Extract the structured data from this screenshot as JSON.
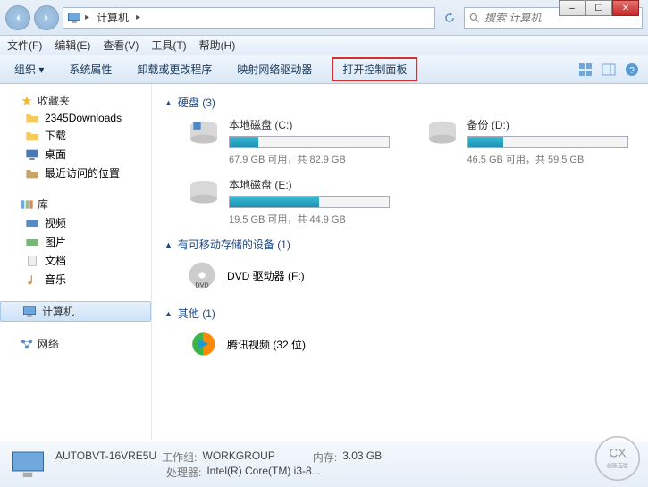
{
  "window_controls": {
    "min": "–",
    "max": "☐",
    "close": "✕"
  },
  "address": {
    "location": "计算机",
    "crumb_arrow": "▸"
  },
  "search": {
    "placeholder": "搜索 计算机"
  },
  "menubar": {
    "file": "文件(F)",
    "edit": "编辑(E)",
    "view": "查看(V)",
    "tools": "工具(T)",
    "help": "帮助(H)"
  },
  "toolbar": {
    "organize": "组织 ▾",
    "items": [
      "系统属性",
      "卸载或更改程序",
      "映射网络驱动器",
      "打开控制面板"
    ]
  },
  "sidebar": {
    "favorites": {
      "label": "收藏夹",
      "items": [
        "2345Downloads",
        "下载",
        "桌面",
        "最近访问的位置"
      ]
    },
    "libraries": {
      "label": "库",
      "items": [
        "视频",
        "图片",
        "文档",
        "音乐"
      ]
    },
    "computer": {
      "label": "计算机"
    },
    "network": {
      "label": "网络"
    }
  },
  "content": {
    "hdd_header": "硬盘 (3)",
    "drives": [
      {
        "name": "本地磁盘 (C:)",
        "stats": "67.9 GB 可用，共 82.9 GB",
        "fill": "small"
      },
      {
        "name": "备份 (D:)",
        "stats": "46.5 GB 可用，共 59.5 GB",
        "fill": "mid"
      },
      {
        "name": "本地磁盘 (E:)",
        "stats": "19.5 GB 可用，共 44.9 GB",
        "fill": "big"
      }
    ],
    "removable_header": "有可移动存储的设备 (1)",
    "dvd": "DVD 驱动器 (F:)",
    "other_header": "其他 (1)",
    "tencent": "腾讯视频 (32 位)"
  },
  "status": {
    "hostname": "AUTOBVT-16VRE5U",
    "workgroup_label": "工作组:",
    "workgroup": "WORKGROUP",
    "mem_label": "内存:",
    "mem": "3.03 GB",
    "cpu_label": "处理器:",
    "cpu": "Intel(R) Core(TM) i3-8..."
  },
  "watermark": "创新互联"
}
